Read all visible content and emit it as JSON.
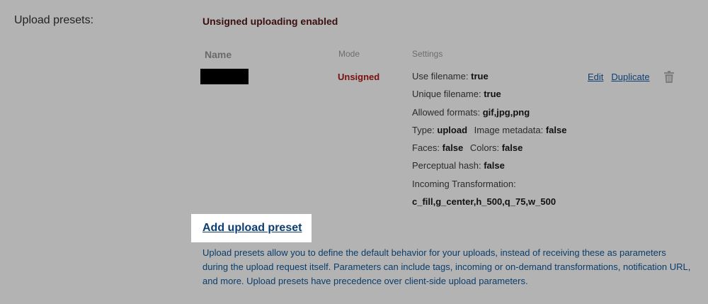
{
  "section": {
    "label": "Upload presets:",
    "status": "Unsigned uploading enabled"
  },
  "table": {
    "headers": {
      "name": "Name",
      "mode": "Mode",
      "settings": "Settings"
    },
    "row": {
      "mode": "Unsigned",
      "settings": {
        "use_filename_label": "Use filename:",
        "use_filename_value": "true",
        "unique_filename_label": "Unique filename:",
        "unique_filename_value": "true",
        "allowed_formats_label": "Allowed formats:",
        "allowed_formats_value": "gif,jpg,png",
        "type_label": "Type:",
        "type_value": "upload",
        "image_metadata_label": "Image metadata:",
        "image_metadata_value": "false",
        "faces_label": "Faces:",
        "faces_value": "false",
        "colors_label": "Colors:",
        "colors_value": "false",
        "perceptual_hash_label": "Perceptual hash:",
        "perceptual_hash_value": "false",
        "incoming_transformation_label": "Incoming Transformation:",
        "incoming_transformation_value": "c_fill,g_center,h_500,q_75,w_500"
      },
      "actions": {
        "edit": "Edit",
        "duplicate": "Duplicate",
        "delete_icon": "trash-icon"
      }
    }
  },
  "add_preset_link": "Add upload preset",
  "help_text": "Upload presets allow you to define the default behavior for your uploads, instead of receiving these as parameters during the upload request itself. Parameters can include tags, incoming or on-demand transformations, notification URL, and more. Upload presets have precedence over client-side upload parameters."
}
